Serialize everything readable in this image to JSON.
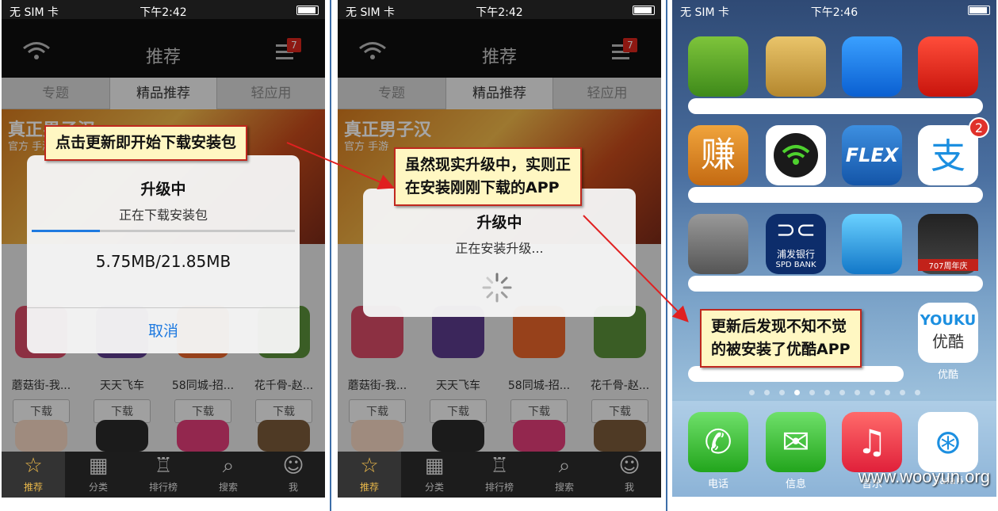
{
  "status": {
    "carrier": "无 SIM 卡",
    "time1": "下午2:42",
    "time2": "下午2:42",
    "time3": "下午2:46"
  },
  "navbar": {
    "title": "推荐",
    "badge": "7"
  },
  "tabs": [
    "专题",
    "精品推荐",
    "轻应用"
  ],
  "banner": {
    "logo": "真正男子汉",
    "sub": "官方  手游"
  },
  "apps": [
    {
      "name": "蘑菇街-我...",
      "download": "下载"
    },
    {
      "name": "天天飞车",
      "download": "下载"
    },
    {
      "name": "58同城-招...",
      "download": "下载"
    },
    {
      "name": "花千骨-赵...",
      "download": "下载"
    }
  ],
  "tabbar": [
    "推荐",
    "分类",
    "排行榜",
    "搜索",
    "我"
  ],
  "dialog1": {
    "title": "升级中",
    "message": "正在下载安装包",
    "size": "5.75MB/21.85MB",
    "cancel": "取消",
    "progress": 0.26
  },
  "dialog2": {
    "title": "升级中",
    "message": "正在安装升级..."
  },
  "callouts": {
    "c1": "点击更新即开始下载安装包",
    "c2_line1": "虽然现实升级中，实则正",
    "c2_line2": "在安装刚刚下载的APP",
    "c3_line1": "更新后发现不知不觉",
    "c3_line2": "的被安装了优酷APP"
  },
  "homescreen": {
    "icons": [
      "donkey-app",
      "contacts-app",
      "qq-app",
      "nike-plus-app",
      "zhuan-app",
      "wifi-app",
      "flex-app",
      "alipay-app",
      "grid-app",
      "spd-bank-app",
      "blue-app",
      "707-app"
    ],
    "flex_label": "FLEX",
    "zhuan_label": "赚",
    "spd_line1": "浦发银行",
    "spd_line2": "SPD BANK",
    "label_707": "707周年庆",
    "alipay_badge": "2",
    "youku_title": "YOUKU",
    "youku_sub": "优酷",
    "youku_label": "优酷",
    "dock": [
      "电话",
      "信息",
      "音乐",
      "Safari"
    ]
  },
  "watermark": "www.wooyun.org"
}
